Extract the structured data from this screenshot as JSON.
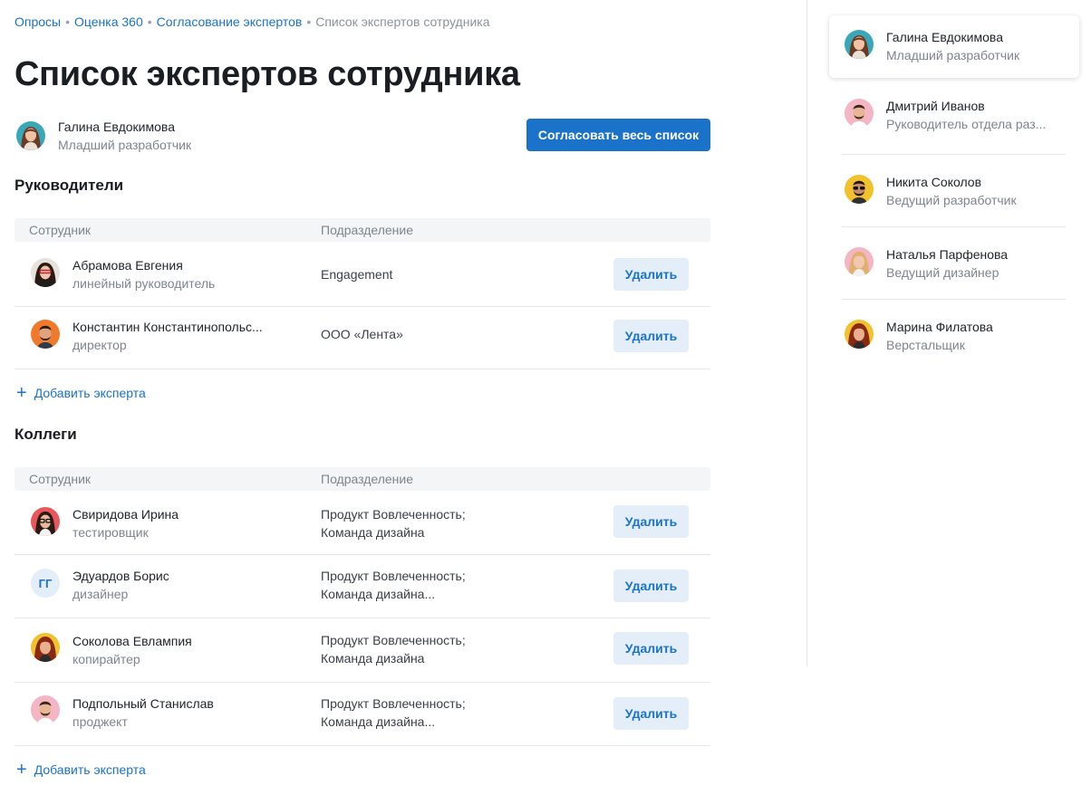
{
  "breadcrumb": {
    "items": [
      "Опросы",
      "Оценка 360",
      "Согласование экспертов"
    ],
    "current": "Список экспертов сотрудника",
    "separator": "•"
  },
  "page_title": "Список экспертов сотрудника",
  "employee": {
    "name": "Галина Евдокимова",
    "role": "Младший разработчик"
  },
  "approve_button": "Согласовать весь список",
  "columns": {
    "employee": "Сотрудник",
    "department": "Подразделение"
  },
  "delete_label": "Удалить",
  "add_expert_label": "Добавить эксперта",
  "sections": {
    "managers": {
      "title": "Руководители",
      "rows": [
        {
          "name": "Абрамова Евгения",
          "role": "линейный руководитель",
          "dept1": "Engagement",
          "dept2": ""
        },
        {
          "name": "Константин Константинопольс...",
          "role": "директор",
          "dept1": "ООО «Лента»",
          "dept2": ""
        }
      ]
    },
    "colleagues": {
      "title": "Коллеги",
      "rows": [
        {
          "name": "Свиридова Ирина",
          "role": "тестировщик",
          "dept1": "Продукт Вовлеченность;",
          "dept2": "Команда дизайна"
        },
        {
          "name": "Эдуардов Борис",
          "role": "дизайнер",
          "dept1": "Продукт Вовлеченность;",
          "dept2": "Команда дизайна...",
          "initials": "ГГ"
        },
        {
          "name": "Соколова Евлампия",
          "role": "копирайтер",
          "dept1": "Продукт Вовлеченность;",
          "dept2": "Команда дизайна"
        },
        {
          "name": "Подпольный Станислав",
          "role": "проджект",
          "dept1": "Продукт Вовлеченность;",
          "dept2": "Команда дизайна..."
        }
      ]
    }
  },
  "sidebar": {
    "items": [
      {
        "name": "Галина Евдокимова",
        "role": "Младший разработчик"
      },
      {
        "name": "Дмитрий Иванов",
        "role": "Руководитель отдела раз..."
      },
      {
        "name": "Никита Соколов",
        "role": "Ведущий разработчик"
      },
      {
        "name": "Наталья Парфенова",
        "role": "Ведущий дизайнер"
      },
      {
        "name": "Марина Филатова",
        "role": "Верстальщик"
      }
    ]
  },
  "colors": {
    "accent": "#1a73c8",
    "accent_light": "#e4eef9",
    "muted": "#7d858e",
    "header_bg": "#f4f5f7"
  }
}
